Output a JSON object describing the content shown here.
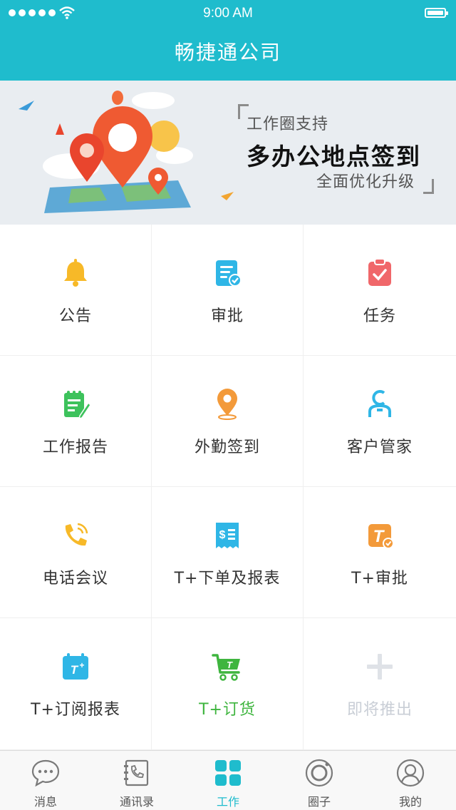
{
  "status_bar": {
    "time": "9:00 AM"
  },
  "header": {
    "title": "畅捷通公司"
  },
  "banner": {
    "line1": "工作圈支持",
    "line2": "多办公地点签到",
    "line3": "全面优化升级"
  },
  "apps": [
    {
      "label": "公告",
      "icon": "bell-icon",
      "color": "#f7b928"
    },
    {
      "label": "审批",
      "icon": "approval-doc-icon",
      "color": "#2fb6e6"
    },
    {
      "label": "任务",
      "icon": "task-clipboard-icon",
      "color": "#f0676a"
    },
    {
      "label": "工作报告",
      "icon": "work-report-icon",
      "color": "#3dc25c"
    },
    {
      "label": "外勤签到",
      "icon": "location-pin-icon",
      "color": "#f39a3a"
    },
    {
      "label": "客户管家",
      "icon": "customer-icon",
      "color": "#2fb6e6"
    },
    {
      "label": "电话会议",
      "icon": "phone-icon",
      "color": "#f7b928"
    },
    {
      "label": "T+下单及报表",
      "icon": "order-receipt-icon",
      "color": "#2fb6e6"
    },
    {
      "label": "T+审批",
      "icon": "tplus-approval-icon",
      "color": "#f39a3a"
    },
    {
      "label": "T+订阅报表",
      "icon": "tplus-calendar-icon",
      "color": "#2fb6e6"
    },
    {
      "label": "T+订货",
      "icon": "shopping-cart-icon",
      "color": "#3fb53f"
    },
    {
      "label": "即将推出",
      "icon": "plus-icon",
      "color": "#d6dae0"
    }
  ],
  "tabs": [
    {
      "label": "消息",
      "icon": "chat-bubble-icon"
    },
    {
      "label": "通讯录",
      "icon": "contacts-phone-icon"
    },
    {
      "label": "工作",
      "icon": "grid-icon",
      "active": true
    },
    {
      "label": "圈子",
      "icon": "circle-icon"
    },
    {
      "label": "我的",
      "icon": "user-profile-icon"
    }
  ],
  "colors": {
    "brand": "#1fbccd",
    "green": "#3fb53f"
  }
}
